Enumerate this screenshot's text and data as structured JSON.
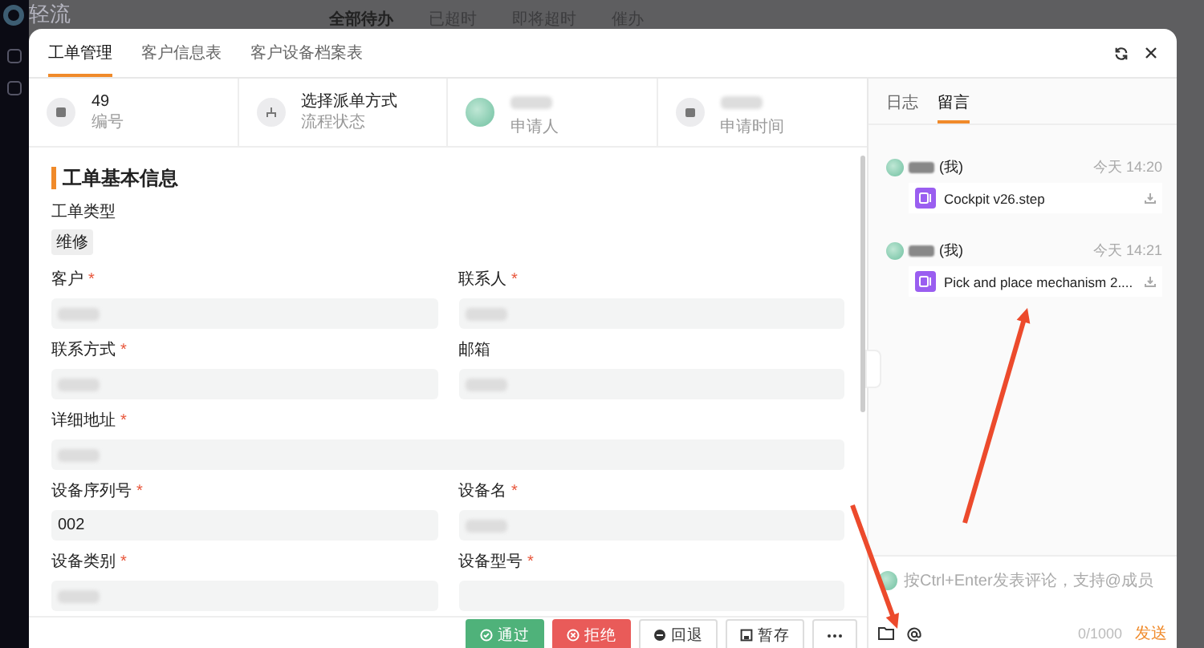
{
  "background": {
    "logo": "轻流",
    "nav": [
      {
        "label": "全部待办",
        "selected": true
      },
      {
        "label": "已超时",
        "selected": false
      },
      {
        "label": "即将超时",
        "selected": false
      },
      {
        "label": "催办",
        "selected": false
      }
    ]
  },
  "modal": {
    "tabs": [
      {
        "label": "工单管理",
        "selected": true
      },
      {
        "label": "客户信息表",
        "selected": false
      },
      {
        "label": "客户设备档案表",
        "selected": false
      }
    ],
    "info": [
      {
        "kind": "icon",
        "value": "49",
        "label": "编号"
      },
      {
        "kind": "icon",
        "value": "选择派单方式",
        "label": "流程状态"
      },
      {
        "kind": "avatar",
        "redacted": true,
        "label": "申请人"
      },
      {
        "kind": "icon",
        "redacted": true,
        "label": "申请时间"
      }
    ],
    "section_title": "工单基本信息",
    "type_field": {
      "label": "工单类型",
      "tag": "维修"
    },
    "fields": [
      {
        "label": "客户",
        "required_mark": "*",
        "redacted": true,
        "wide": false
      },
      {
        "label": "联系人",
        "required_mark": "*",
        "redacted": true,
        "wide": false
      },
      {
        "label": "联系方式",
        "required_mark": "*",
        "redacted": true,
        "wide": false
      },
      {
        "label": "邮箱",
        "redacted": true,
        "wide": false
      },
      {
        "label": "详细地址",
        "required_mark": "*",
        "redacted": true,
        "wide": true
      },
      {
        "label": "设备序列号",
        "required_mark": "*",
        "value": "002",
        "redacted": false,
        "wide": false
      },
      {
        "label": "设备名",
        "required_mark": "*",
        "redacted": true,
        "wide": false
      },
      {
        "label": "设备类别",
        "required_mark": "*",
        "redacted": true,
        "wide": false
      },
      {
        "label": "设备型号",
        "required_mark": "*",
        "wide": false
      }
    ],
    "buttons": [
      {
        "kind": "approve",
        "label": "通过"
      },
      {
        "kind": "reject",
        "label": "拒绝"
      },
      {
        "kind": "back",
        "label": "回退"
      },
      {
        "kind": "save",
        "label": "暂存"
      },
      {
        "kind": "more"
      }
    ],
    "side_tabs": [
      {
        "label": "日志",
        "selected": false
      },
      {
        "label": "留言",
        "selected": true
      }
    ],
    "messages": [
      {
        "me": "(我)",
        "time": "今天 14:20",
        "file": "Cockpit v26.step"
      },
      {
        "me": "(我)",
        "time": "今天 14:21",
        "file": "Pick and place mechanism 2...."
      }
    ],
    "composer": {
      "placeholder": "按Ctrl+Enter发表评论，支持@成员",
      "counter": "0/1000",
      "send": "发送"
    }
  },
  "annotations": [
    {
      "kind": "arrow",
      "color": "#ec4a2c"
    },
    {
      "kind": "arrow",
      "color": "#ec4a2c"
    }
  ]
}
